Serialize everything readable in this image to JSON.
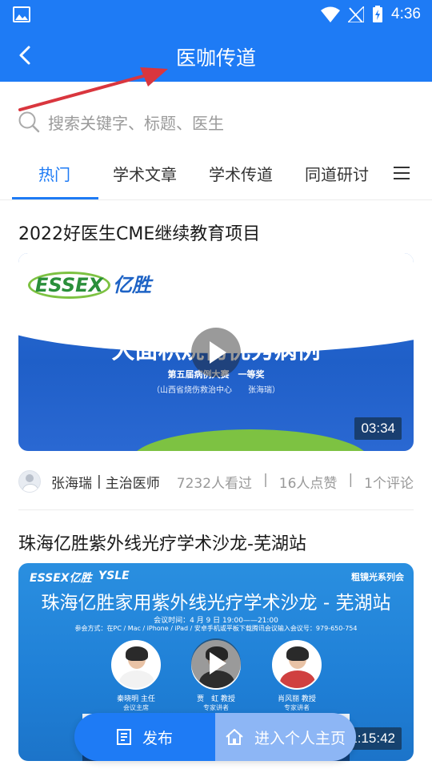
{
  "status_bar": {
    "time": "4:36"
  },
  "app_bar": {
    "title": "医咖传道"
  },
  "search": {
    "placeholder": "搜索关键字、标题、医生"
  },
  "tabs": [
    {
      "label": "热门",
      "active": true
    },
    {
      "label": "学术文章",
      "active": false
    },
    {
      "label": "学术传道",
      "active": false
    },
    {
      "label": "同道研讨",
      "active": false
    }
  ],
  "cards": [
    {
      "title": "2022好医生CME继续教育项目",
      "thumbnail": {
        "logo_en": "ESSEX",
        "logo_cn": "亿胜",
        "headline": "大面积烧伤优秀病例",
        "sub1": "第五届病例大赛　一等奖",
        "sub2": "（山西省烧伤救治中心　　张海瑞）"
      },
      "duration": "03:34",
      "author": "张海瑞",
      "author_title": "主治医师",
      "views": "7232人看过",
      "likes": "16人点赞",
      "comments": "1个评论"
    },
    {
      "title": "珠海亿胜紫外线光疗学术沙龙-芜湖站",
      "thumbnail": {
        "logo_en": "ESSEX亿胜",
        "logo2": "YSLE",
        "series": "粗镜光系列会",
        "headline": "珠海亿胜家用紫外线光疗学术沙龙 - 芜湖站",
        "info1": "会议时间：4 月 9 日 19:00——21:00",
        "info2": "参会方式：在PC / Mac / iPhone / iPad / 安卓手机或平板下载腾讯会议输入会议号：979-650-754",
        "speakers": [
          {
            "name": "秦晓明  主任",
            "role": "会议主席"
          },
          {
            "name": "贾　虹  教授",
            "role": "专家讲者"
          },
          {
            "name": "肖风丽  教授",
            "role": "专家讲者"
          }
        ]
      },
      "duration": "1:15:42"
    }
  ],
  "bottom_bar": {
    "publish": "发布",
    "home": "进入个人主页"
  },
  "colors": {
    "primary": "#1e7bf5",
    "annotation_arrow": "#d9363e"
  }
}
